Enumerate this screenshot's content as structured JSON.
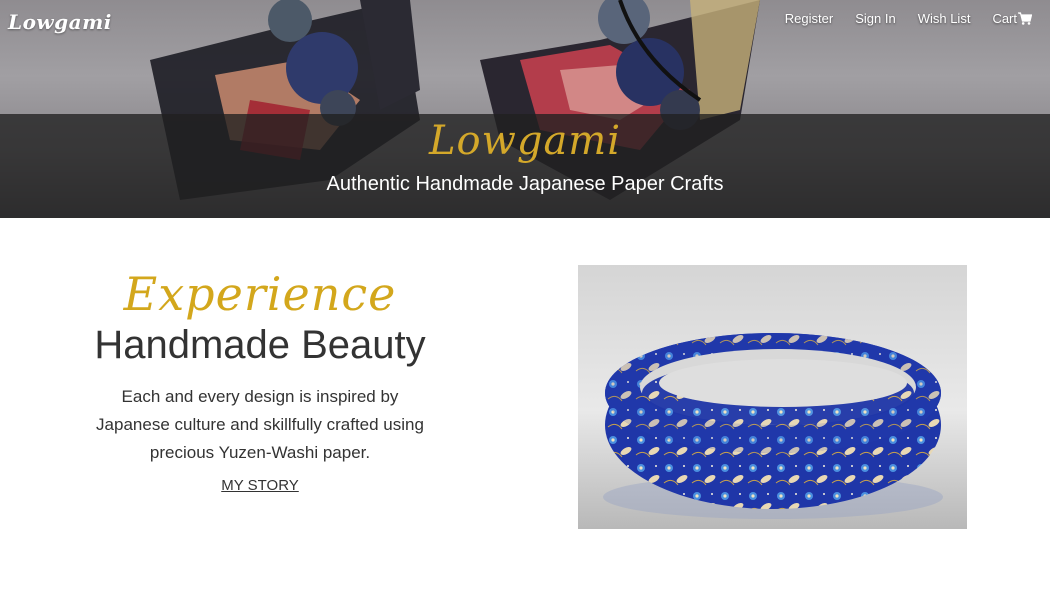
{
  "nav": {
    "logo": "Lowgami",
    "links": [
      "Register",
      "Sign In",
      "Wish List",
      "Cart"
    ],
    "cart_icon": "shopping-cart-icon"
  },
  "hero": {
    "title": "Lowgami",
    "subtitle": "Authentic Handmade Japanese Paper Crafts",
    "image": "origami-crane-earrings-photo"
  },
  "intro": {
    "kicker": "Experience",
    "heading": "Handmade Beauty",
    "body": "Each and every design is inspired by Japanese culture and skillfully crafted using precious Yuzen-Washi paper.",
    "link": "MY STORY"
  },
  "product": {
    "image": "yuzen-washi-bangle-photo"
  },
  "colors": {
    "accent": "#d3a71c",
    "text": "#333333",
    "band": "#202020"
  }
}
